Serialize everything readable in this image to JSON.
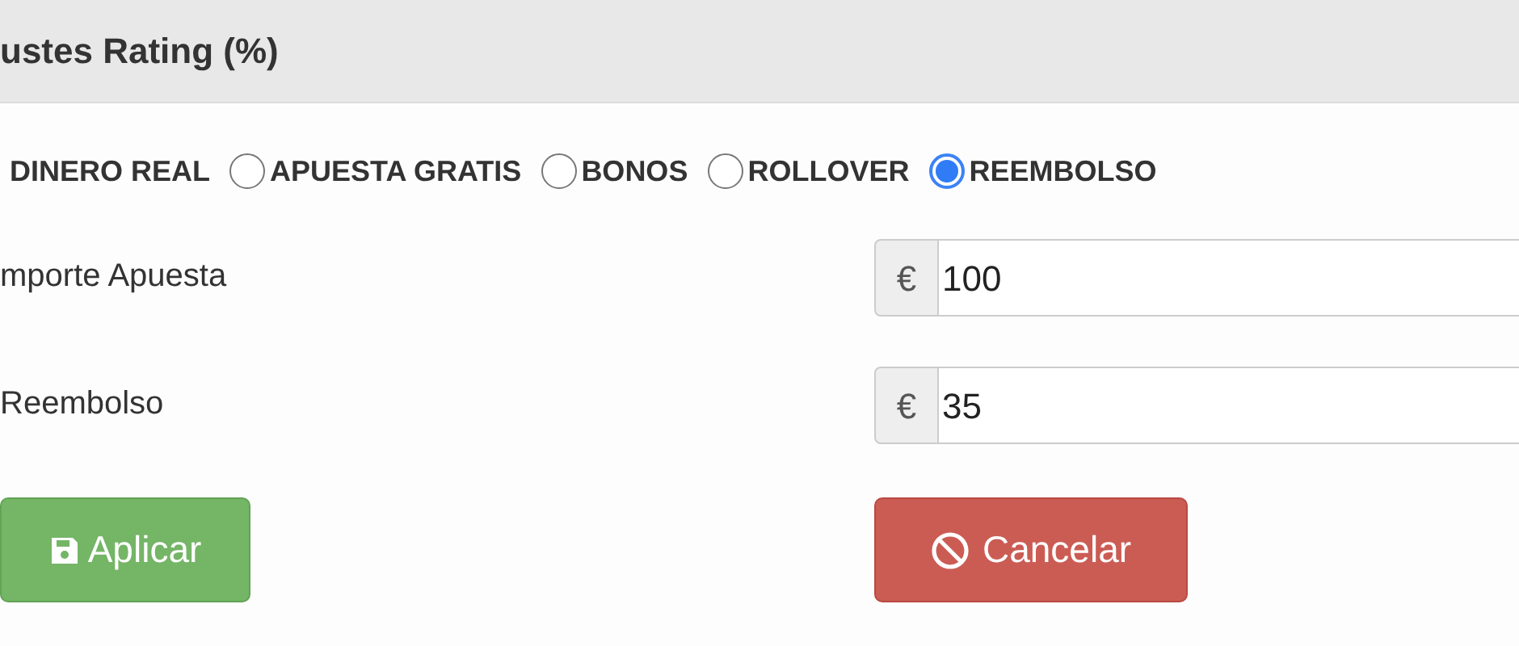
{
  "panel": {
    "title": "ustes Rating (%)"
  },
  "options": [
    {
      "label": "DINERO REAL"
    },
    {
      "label": "APUESTA GRATIS",
      "selected": false
    },
    {
      "label": "BONOS",
      "selected": false
    },
    {
      "label": "ROLLOVER",
      "selected": false
    },
    {
      "label": "REEMBOLSO",
      "selected": true
    }
  ],
  "fields": [
    {
      "label": "mporte Apuesta",
      "addon": "€",
      "value": "100"
    },
    {
      "label": "Reembolso",
      "addon": "€",
      "value": "35"
    }
  ],
  "buttons": [
    {
      "kind": "apply",
      "label": "Aplicar"
    },
    {
      "kind": "cancel",
      "label": "Cancelar"
    }
  ]
}
